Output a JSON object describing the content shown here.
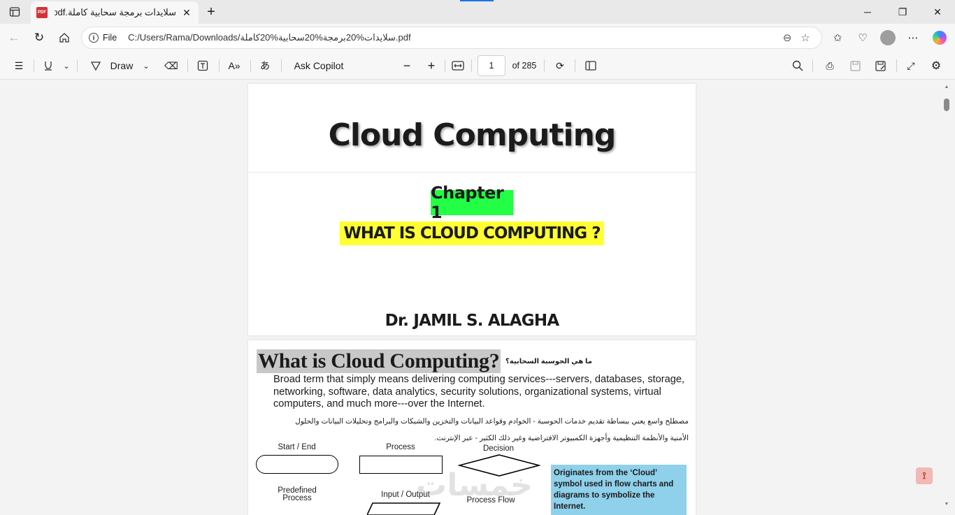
{
  "browser": {
    "tab_title": "سلايدات برمجة سحابية كاملة.pdf",
    "tab_icon_label": "PDF",
    "address": {
      "scheme_label": "File",
      "url": "C:/Users/Rama/Downloads/سلايدات%20برمجة%20سحابية%20كاملة.pdf"
    }
  },
  "pdf_toolbar": {
    "draw_label": "Draw",
    "ask_copilot_label": "Ask Copilot",
    "page_number": "1",
    "page_count_label": "of 285"
  },
  "page1": {
    "title": "Cloud Computing",
    "chapter": "Chapter 1",
    "subtitle": "WHAT IS CLOUD COMPUTING ?",
    "author": "Dr. JAMIL S. ALAGHA",
    "colors": {
      "chapter_bg": "#22ff44",
      "subtitle_bg": "#ffff33"
    }
  },
  "page2": {
    "heading": "What is Cloud Computing?",
    "arabic_question": "ما هي الحوسبة السحابية؟",
    "paragraph": "Broad term that simply means delivering computing services---servers,  databases, storage, networking, software, data analytics, security solutions, organizational systems, virtual computers, and much more---over the  Internet.",
    "arabic_line1": "مصطلح واسع يعني ببساطة تقديم خدمات الحوسبة - الخوادم وقواعد البيانات والتخزين والشبكات والبرامج وتحليلات البيانات والحلول",
    "arabic_line2": "الأمنية والأنظمة التنظيمية وأجهزة الكمبيوتر الافتراضية وغير ذلك الكثير - عبر الإنترنت.",
    "flowchart_labels": {
      "start_end": "Start / End",
      "process": "Process",
      "decision": "Decision",
      "predefined": "Predefined Process",
      "input_output": "Input / Output",
      "process_flow": "Process Flow"
    },
    "callout": "Originates from the ‘Cloud’ symbol  used in flow charts and diagrams to symbolize the Internet.",
    "watermark": "خمسات",
    "colors": {
      "callout_bg": "#8fd0ea",
      "heading_bg": "#c8c8c8"
    }
  }
}
